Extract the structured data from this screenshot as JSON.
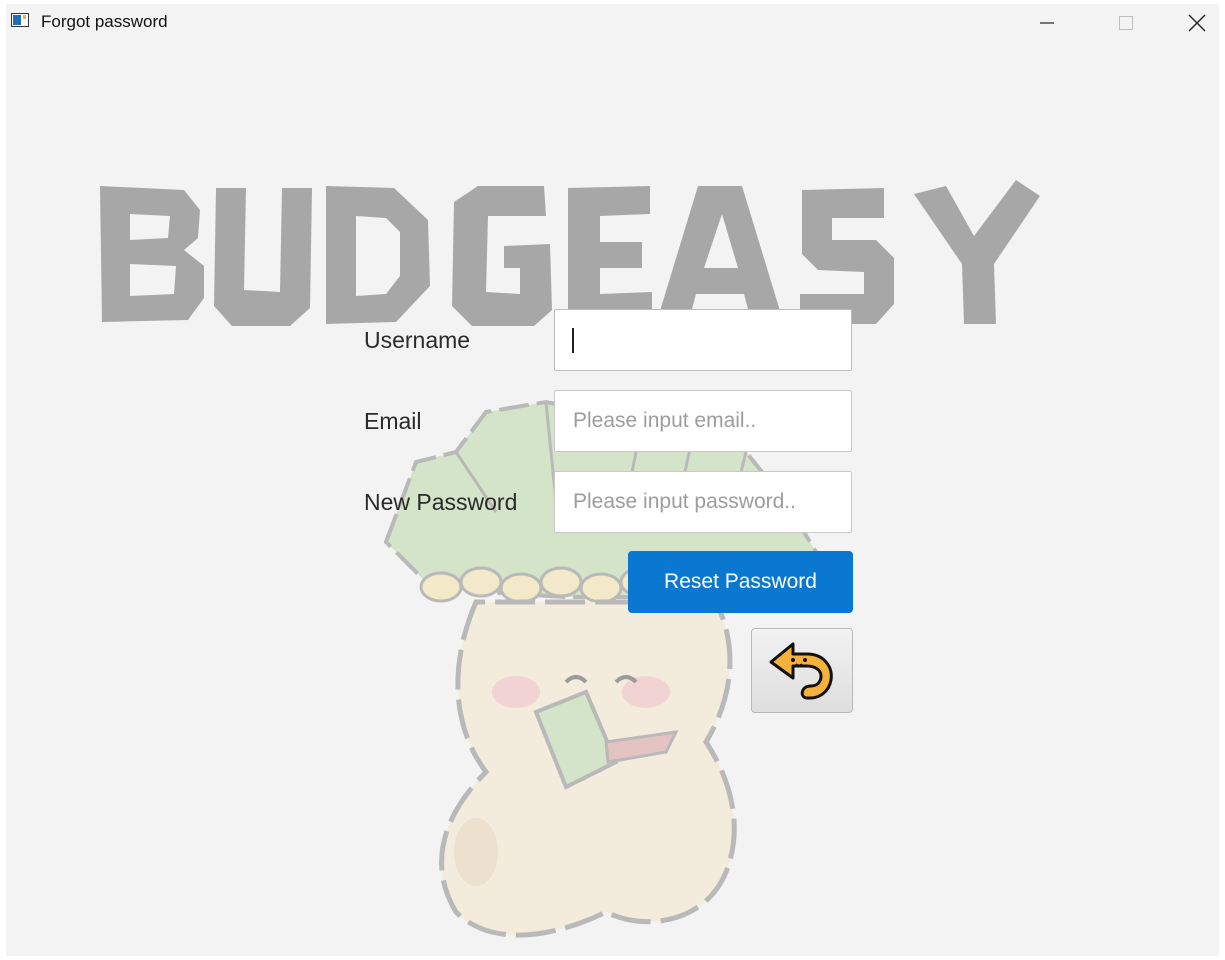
{
  "window": {
    "title": "Forgot password"
  },
  "logo": {
    "text": "BUDGEASY",
    "color": "#a5a5a5"
  },
  "form": {
    "username_label": "Username",
    "username_value": "",
    "email_label": "Email",
    "email_placeholder": "Please input email..",
    "password_label": "New Password",
    "password_placeholder": "Please input password..",
    "reset_button_label": "Reset Password",
    "back_button_icon": "back-arrow-icon"
  },
  "colors": {
    "accent": "#0a78d1",
    "window_bg": "#f3f3f3"
  }
}
